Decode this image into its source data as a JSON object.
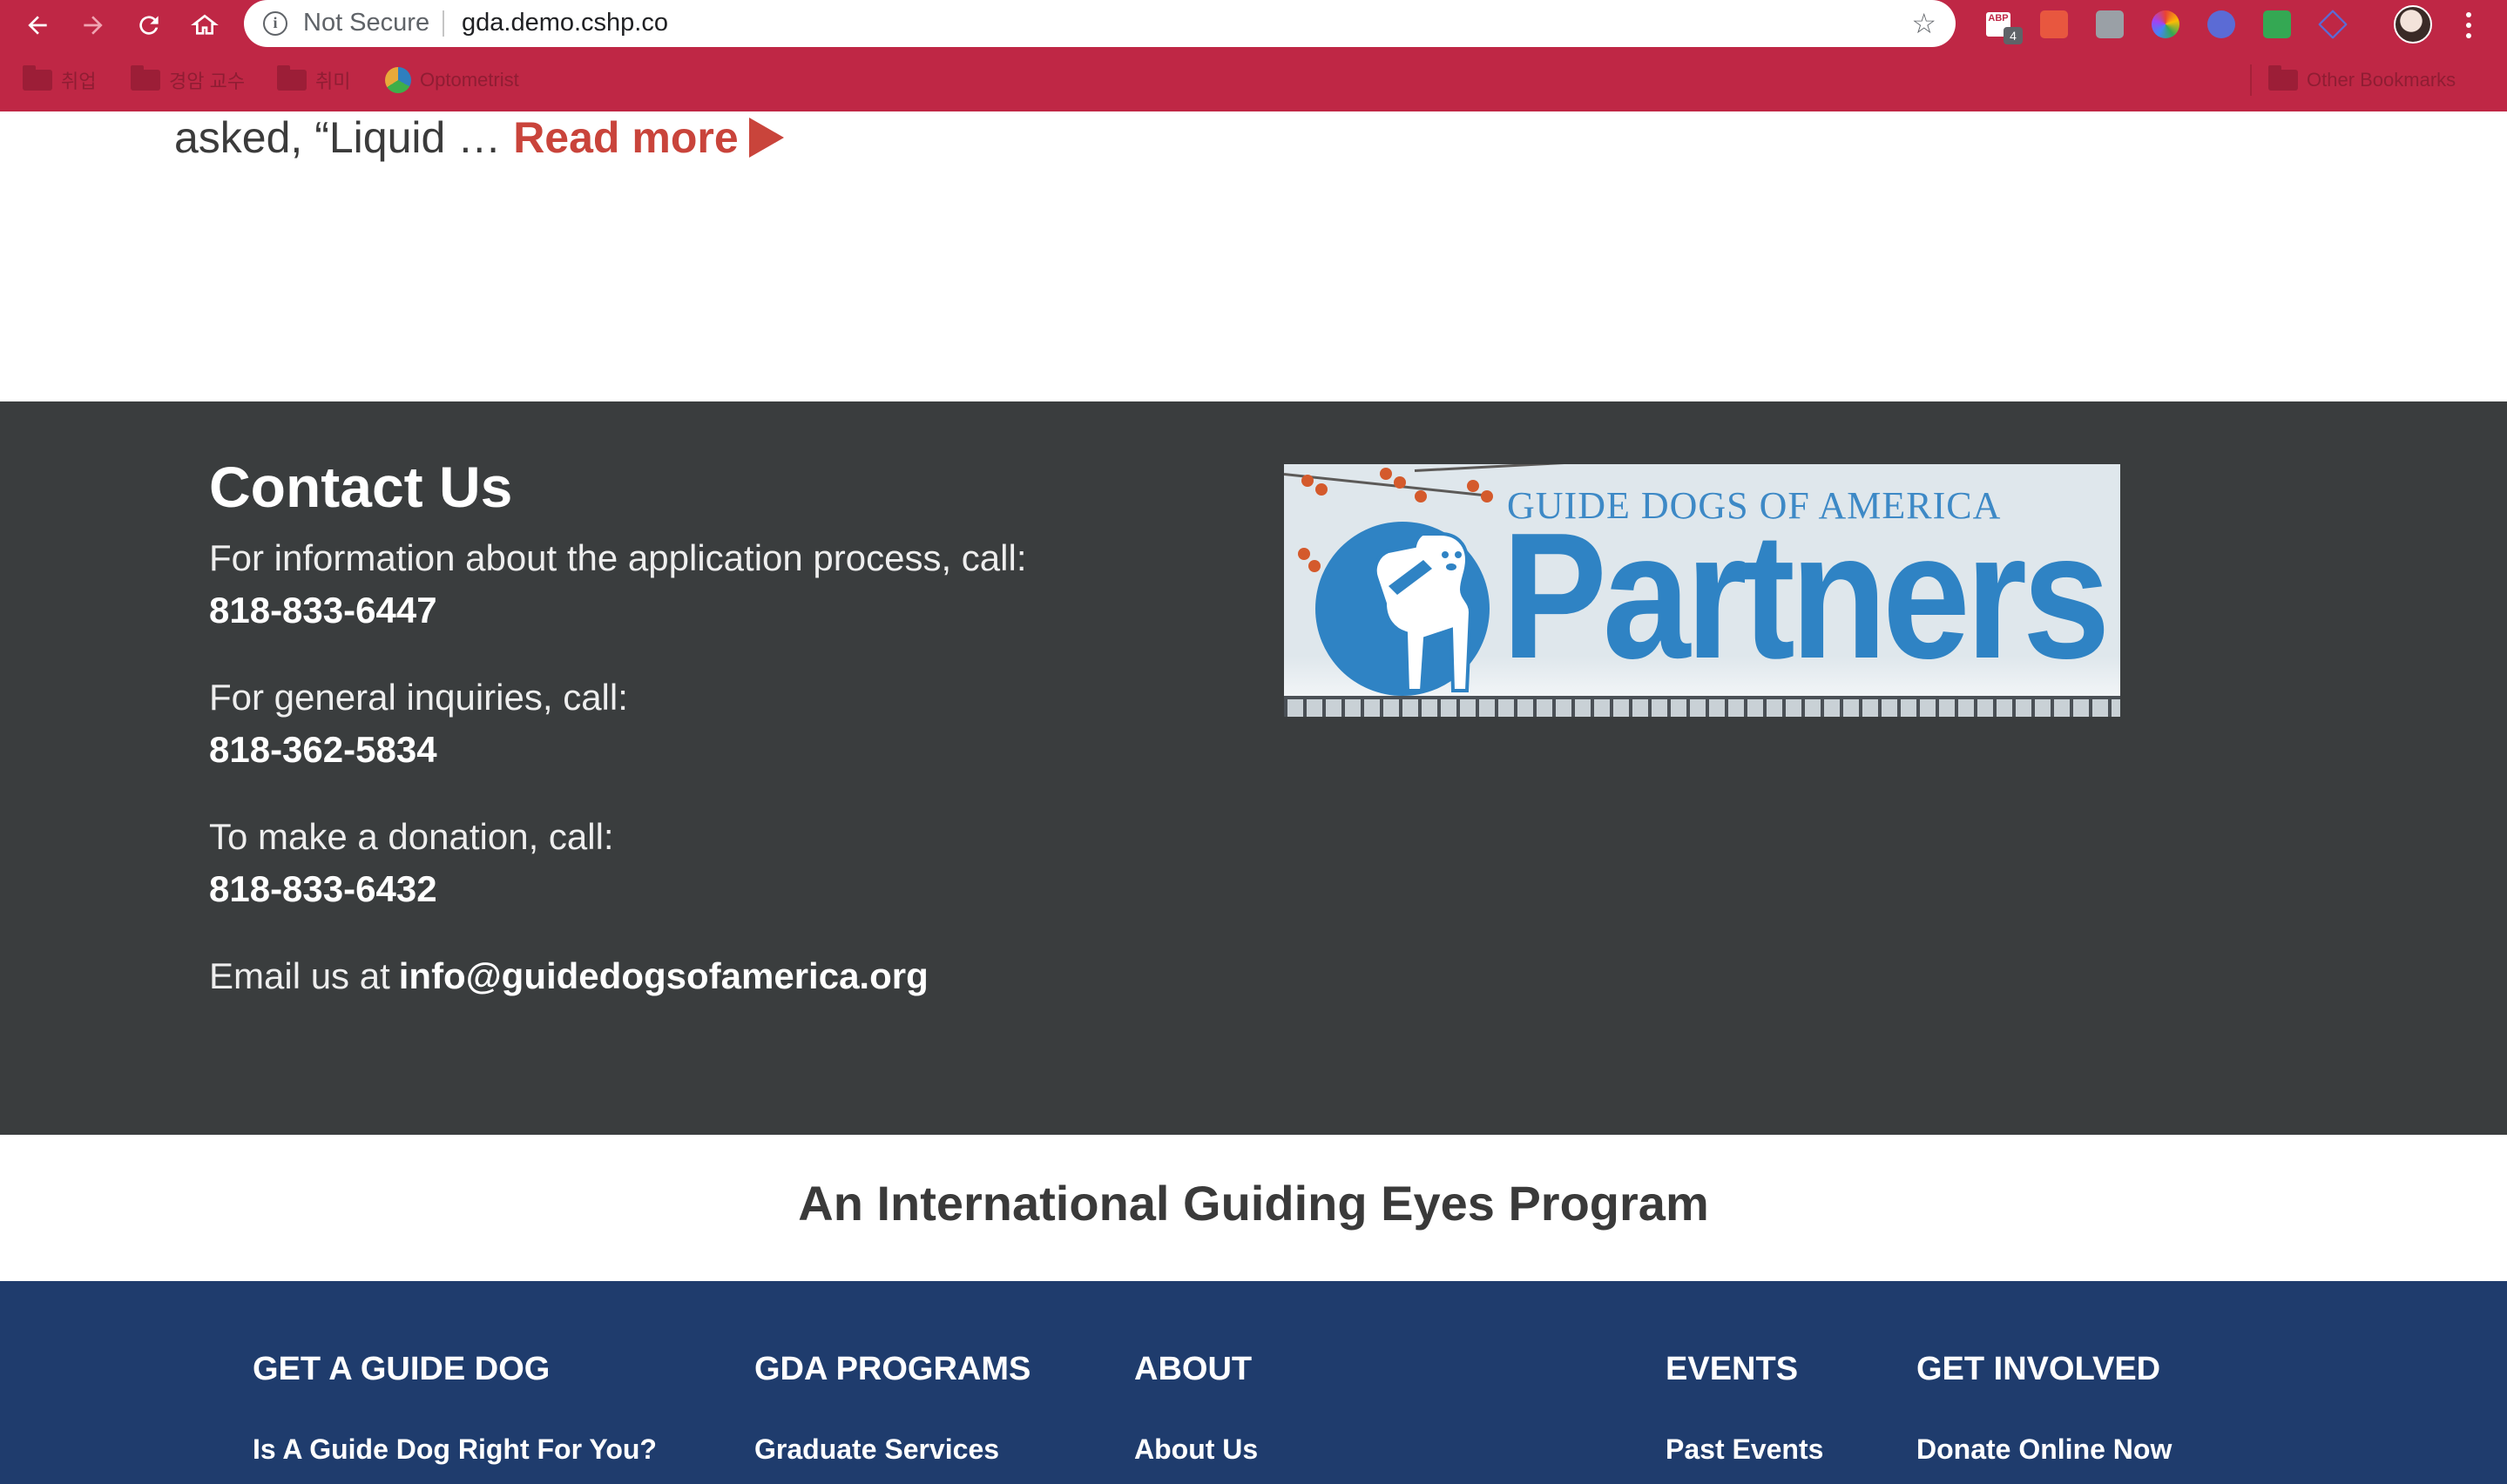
{
  "browser": {
    "security_label": "Not Secure",
    "url": "gda.demo.cshp.co",
    "extension_badge": "4",
    "extension_abp_label": "ABP",
    "bookmarks": [
      {
        "label": "취업",
        "icon": "folder-icon"
      },
      {
        "label": "경암 교수",
        "icon": "folder-icon"
      },
      {
        "label": "취미",
        "icon": "folder-icon"
      },
      {
        "label": "Optometrist",
        "icon": "globe-icon"
      }
    ],
    "other_bookmarks": "Other Bookmarks",
    "accent_color": "#bf2745"
  },
  "article": {
    "excerpt_end": "asked, “Liquid …",
    "read_more": "Read more"
  },
  "contact": {
    "title": "Contact Us",
    "application_text": "For information about the application process, call:",
    "application_phone": "818-833-6447",
    "general_text": "For general inquiries, call:",
    "general_phone": "818-362-5834",
    "donation_text": "To make a donation, call:",
    "donation_phone": "818-833-6432",
    "email_prefix": "Email us at",
    "email": "info@guidedogsofamerica.org"
  },
  "partners_logo": {
    "top_text": "GUIDE DOGS OF AMERICA",
    "main_text": "Partners"
  },
  "tagline": "An International Guiding Eyes Program",
  "footer": {
    "columns": [
      {
        "heading": "GET A GUIDE DOG",
        "first_link": "Is A Guide Dog Right For You?"
      },
      {
        "heading": "GDA PROGRAMS",
        "first_link": "Graduate Services"
      },
      {
        "heading": "ABOUT",
        "first_link": "About Us"
      },
      {
        "heading": "EVENTS",
        "first_link": "Past Events"
      },
      {
        "heading": "GET INVOLVED",
        "first_link": "Donate Online Now"
      }
    ]
  },
  "colors": {
    "contact_bg": "#3a3d3e",
    "footer_bg": "#1f3c6d",
    "read_more": "#c9443b",
    "logo_blue": "#2f83c4"
  }
}
